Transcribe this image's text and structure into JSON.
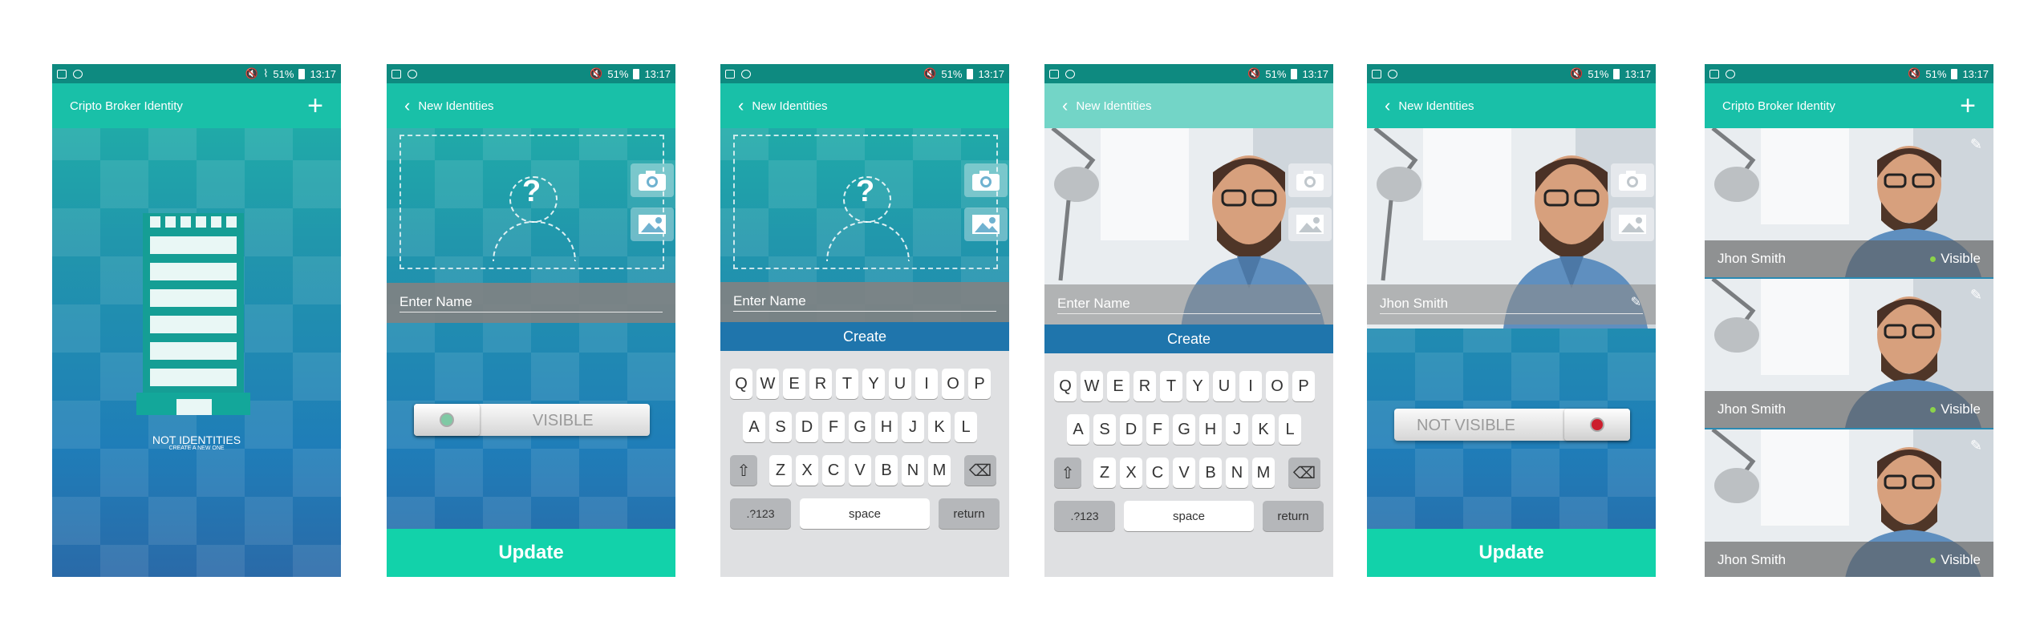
{
  "status": {
    "volume_icon": "mute-icon",
    "battery": "51%",
    "time": "13:17"
  },
  "screen1": {
    "title": "Cripto Broker Identity",
    "empty_title": "NOT IDENTITIES",
    "empty_subtitle": "CREATE A NEW ONE",
    "add_icon": "plus-icon"
  },
  "screen2": {
    "title": "New Identities",
    "name_placeholder": "Enter Name",
    "toggle_label": "VISIBLE",
    "button": "Update"
  },
  "screen3": {
    "title": "New Identities",
    "name_placeholder": "Enter Name",
    "create": "Create",
    "keys": {
      "row1": [
        "Q",
        "W",
        "E",
        "R",
        "T",
        "Y",
        "U",
        "I",
        "O",
        "P"
      ],
      "row2": [
        "A",
        "S",
        "D",
        "F",
        "G",
        "H",
        "J",
        "K",
        "L"
      ],
      "row3": [
        "Z",
        "X",
        "C",
        "V",
        "B",
        "N",
        "M"
      ],
      "num": ".?123",
      "space": "space",
      "return": "return"
    }
  },
  "screen4": {
    "title": "New Identities",
    "name_placeholder": "Enter Name",
    "create": "Create"
  },
  "screen5": {
    "title": "New Identities",
    "name_value": "Jhon Smith",
    "toggle_label": "NOT VISIBLE",
    "button": "Update"
  },
  "screen6": {
    "title": "Cripto Broker Identity",
    "items": [
      {
        "name": "Jhon Smith",
        "status": "Visible"
      },
      {
        "name": "Jhon Smith",
        "status": "Visible"
      },
      {
        "name": "Jhon Smith",
        "status": "Visible"
      }
    ]
  },
  "colors": {
    "teal": "#19c0a8",
    "blue": "#1f75ac",
    "update": "#12d2aa",
    "dot_on": "#8bd34a",
    "dot_off": "#cc1e2d"
  }
}
